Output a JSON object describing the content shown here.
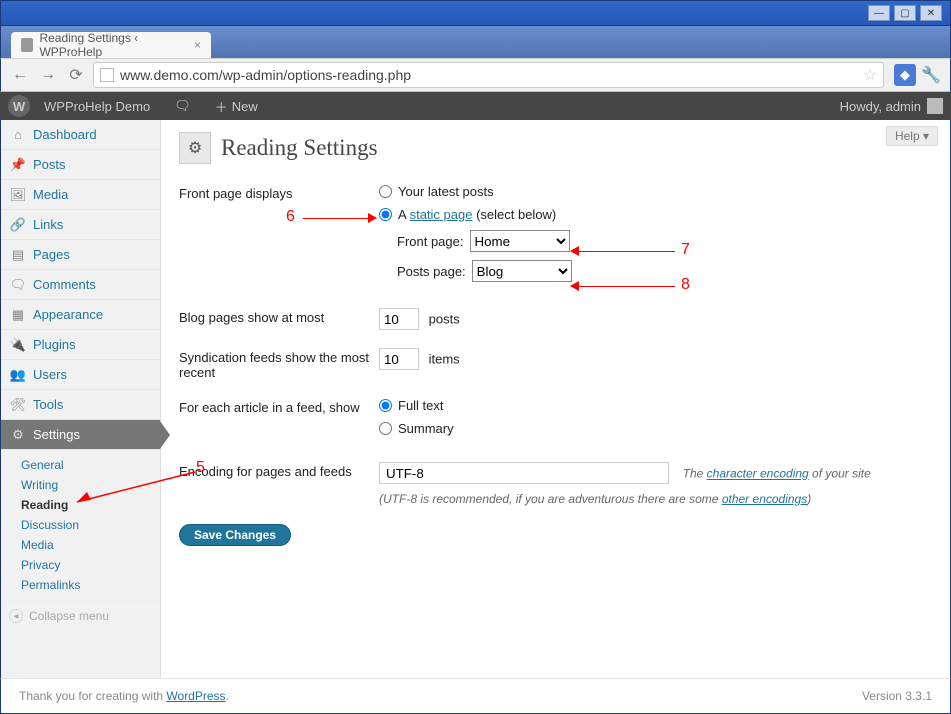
{
  "window": {
    "min": "—",
    "max": "▢",
    "close": "✕"
  },
  "tab": {
    "title": "Reading Settings ‹ WPProHelp"
  },
  "nav": {
    "back": "←",
    "fwd": "→",
    "reload": "⟳"
  },
  "url": "www.demo.com/wp-admin/options-reading.php",
  "adminbar": {
    "site": "WPProHelp Demo",
    "comment_icon": "💬",
    "new": "New",
    "howdy": "Howdy, admin"
  },
  "menu": {
    "dashboard": "Dashboard",
    "posts": "Posts",
    "media": "Media",
    "links": "Links",
    "pages": "Pages",
    "comments": "Comments",
    "appearance": "Appearance",
    "plugins": "Plugins",
    "users": "Users",
    "tools": "Tools",
    "settings": "Settings",
    "sub": {
      "general": "General",
      "writing": "Writing",
      "reading": "Reading",
      "discussion": "Discussion",
      "media": "Media",
      "privacy": "Privacy",
      "permalinks": "Permalinks"
    },
    "collapse": "Collapse menu"
  },
  "page": {
    "help": "Help ▾",
    "title": "Reading Settings",
    "labels": {
      "frontpage": "Front page displays",
      "blogpages": "Blog pages show at most",
      "syndication": "Syndication feeds show the most recent",
      "feedshow": "For each article in a feed, show",
      "encoding": "Encoding for pages and feeds"
    },
    "frontpage": {
      "latest": "Your latest posts",
      "static_a": "A ",
      "static_link": "static page",
      "static_b": " (select below)",
      "front_label": "Front page:",
      "front_value": "Home",
      "posts_label": "Posts page:",
      "posts_value": "Blog"
    },
    "blogpages_value": "10",
    "posts_suffix": "posts",
    "syndication_value": "10",
    "items_suffix": "items",
    "feed": {
      "fulltext": "Full text",
      "summary": "Summary"
    },
    "encoding_value": "UTF-8",
    "encoding_desc_a": "The ",
    "encoding_link1": "character encoding",
    "encoding_desc_b": " of your site",
    "encoding_desc2_a": "(UTF-8 is recommended, if you are adventurous there are some ",
    "encoding_link2": "other encodings",
    "encoding_desc2_b": ")",
    "save": "Save Changes"
  },
  "footer": {
    "thank_a": "Thank you for creating with ",
    "wp": "WordPress",
    "dot": ".",
    "version": "Version 3.3.1"
  },
  "annotations": {
    "n5": "5",
    "n6": "6",
    "n7": "7",
    "n8": "8"
  }
}
